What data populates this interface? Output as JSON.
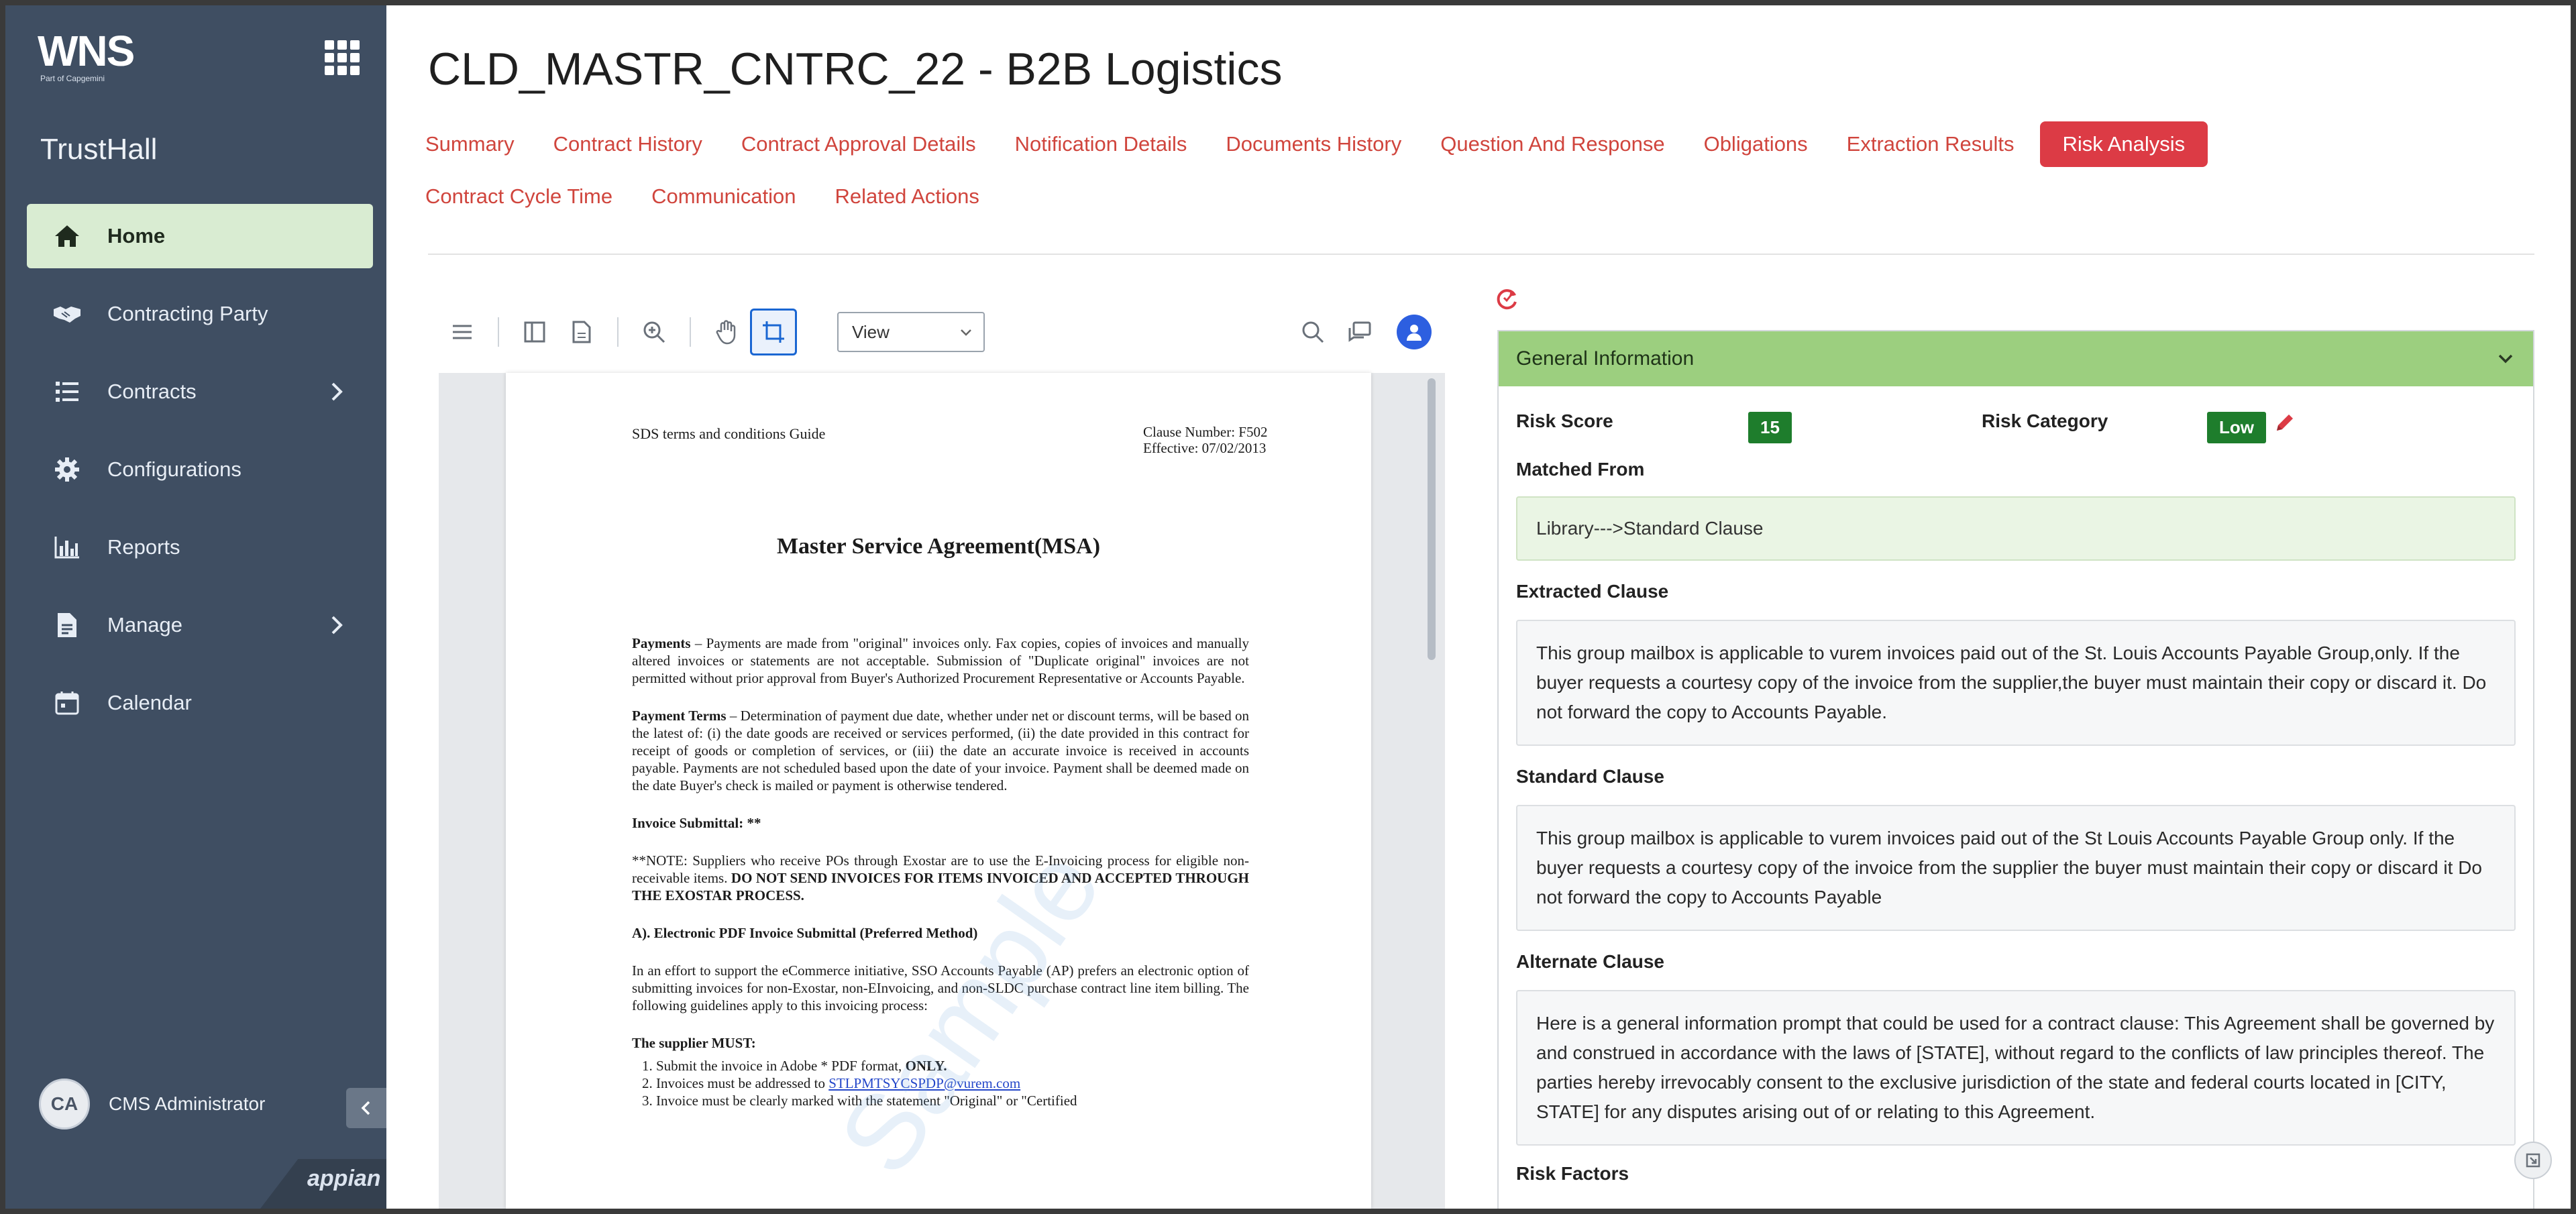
{
  "brand": {
    "logo_text": "WNS",
    "logo_tagline": "Part of Capgemini",
    "app_name": "TrustHall",
    "footer_logo": "appian"
  },
  "sidebar": {
    "items": [
      {
        "label": "Home",
        "icon": "home-icon",
        "active": true,
        "has_submenu": false
      },
      {
        "label": "Contracting Party",
        "icon": "handshake-icon",
        "active": false,
        "has_submenu": false
      },
      {
        "label": "Contracts",
        "icon": "list-icon",
        "active": false,
        "has_submenu": true
      },
      {
        "label": "Configurations",
        "icon": "gear-icon",
        "active": false,
        "has_submenu": false
      },
      {
        "label": "Reports",
        "icon": "bar-chart-icon",
        "active": false,
        "has_submenu": false
      },
      {
        "label": "Manage",
        "icon": "document-icon",
        "active": false,
        "has_submenu": true
      },
      {
        "label": "Calendar",
        "icon": "calendar-icon",
        "active": false,
        "has_submenu": false
      }
    ],
    "user": {
      "initials": "CA",
      "name": "CMS Administrator"
    }
  },
  "page": {
    "title": "CLD_MASTR_CNTRC_22 - B2B Logistics"
  },
  "tabs": {
    "row1": [
      "Summary",
      "Contract History",
      "Contract Approval Details",
      "Notification Details",
      "Documents History",
      "Question And Response",
      "Obligations",
      "Extraction Results",
      "Risk Analysis"
    ],
    "row2": [
      "Contract Cycle Time",
      "Communication",
      "Related Actions"
    ],
    "active": "Risk Analysis"
  },
  "viewer": {
    "view_mode": "View",
    "document": {
      "header_left": "SDS terms and conditions Guide",
      "header_right_1": "Clause Number: F502",
      "header_right_2": "Effective: 07/02/2013",
      "title": "Master Service Agreement(MSA)",
      "p1_lead": "Payments",
      "p1": " – Payments are made from \"original\" invoices only. Fax copies, copies of invoices and manually altered invoices or statements are not acceptable. Submission of \"Duplicate original\" invoices are not permitted without prior approval from Buyer's Authorized Procurement Representative or Accounts Payable.",
      "p2_lead": "Payment Terms",
      "p2": " – Determination of payment due date, whether under net or discount terms, will be based on the latest of: (i) the date goods are received or services performed, (ii) the date provided in this contract for receipt of goods or completion of services, or (iii) the date an accurate invoice is received in accounts payable. Payments are not scheduled based upon the date of your invoice. Payment shall be deemed made on the date Buyer's check is mailed or payment is otherwise tendered.",
      "p3": "Invoice Submittal: **",
      "p4": "**NOTE: Suppliers who receive POs through Exostar are to use the E-Invoicing process for eligible non-receivable items.",
      "p4_bold": " DO NOT SEND INVOICES FOR ITEMS INVOICED AND ACCEPTED THROUGH THE EXOSTAR PROCESS.",
      "p5": "A). Electronic PDF Invoice Submittal (Preferred Method)",
      "p6": "In an effort to support the eCommerce initiative, SSO Accounts Payable (AP) prefers an electronic option of submitting invoices for non-Exostar, non-EInvoicing, and non-SLDC purchase contract line item billing. The following guidelines apply to this invoicing process:",
      "p7": "The supplier MUST:",
      "li1_a": "Submit the invoice in Adobe * PDF format,",
      "li1_b": " ONLY.",
      "li2_a": "Invoices must be addressed to ",
      "li2_link": "STLPMTSYCSPDP@vurem.com",
      "li3": "Invoice must be clearly marked with the statement \"Original\" or \"Certified",
      "watermark": "Sample"
    }
  },
  "risk": {
    "section_title": "General Information",
    "risk_score_label": "Risk Score",
    "risk_score": "15",
    "risk_category_label": "Risk Category",
    "risk_category": "Low",
    "matched_from_label": "Matched From",
    "matched_from": "Library--->Standard Clause",
    "extracted_label": "Extracted Clause",
    "extracted": "This group mailbox is applicable to vurem invoices paid out of the St. Louis Accounts Payable Group,only. If the buyer requests a courtesy copy of the invoice from the supplier,the buyer must maintain their copy or discard it. Do not forward the copy to Accounts Payable.",
    "standard_label": "Standard Clause",
    "standard": "This group mailbox is applicable to vurem invoices paid out of the St Louis Accounts Payable Group only. If the buyer requests a courtesy copy of the invoice from the supplier the buyer must maintain their copy or discard it Do not forward the copy to Accounts Payable",
    "alternate_label": "Alternate Clause",
    "alternate": "Here is a general information prompt that could be used for a contract clause: This Agreement shall be governed by and construed in accordance with the laws of [STATE], without regard to the conflicts of law principles thereof. The parties hereby irrevocably consent to the exclusive jurisdiction of the state and federal courts located in [CITY, STATE] for any disputes arising out of or relating to this Agreement.",
    "risk_factors_label": "Risk Factors"
  },
  "colors": {
    "sidebar": "#3f4e62",
    "active_nav": "#d9ecd2",
    "tab_text": "#d0453d",
    "tab_active": "#dc3b45",
    "panel_header": "#9ccf7f",
    "badge": "#1e7d2c"
  }
}
